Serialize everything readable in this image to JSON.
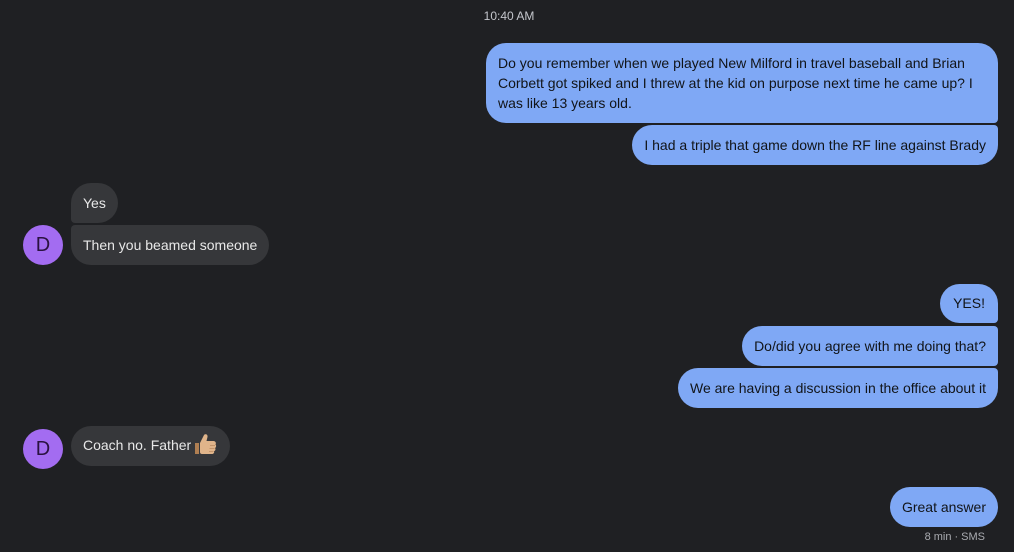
{
  "timestamp": "10:40 AM",
  "messages": [
    {
      "text": "Do you remember when we played New Milford in travel baseball and Brian Corbett got spiked and I threw at the kid on purpose next time he came up? I was like 13 years old."
    },
    {
      "text": "I had a triple that game down the RF line against Brady"
    },
    {
      "text": "Yes"
    },
    {
      "text": "Then you beamed someone"
    },
    {
      "text": "YES!"
    },
    {
      "text": "Do/did you agree with me doing that?"
    },
    {
      "text": "We are having a discussion in the office about it"
    },
    {
      "text": "Coach no. Father",
      "emoji_icon": "thumbs-up-emoji"
    },
    {
      "text": "Great answer"
    }
  ],
  "contact": {
    "avatar_initial": "D",
    "avatar_color": "#a36cf1"
  },
  "colors": {
    "outgoing": "#7fa8f5",
    "incoming": "#36373a",
    "background": "#1f2023"
  },
  "status": {
    "age": "8 min",
    "separator": "·",
    "channel": "SMS"
  }
}
